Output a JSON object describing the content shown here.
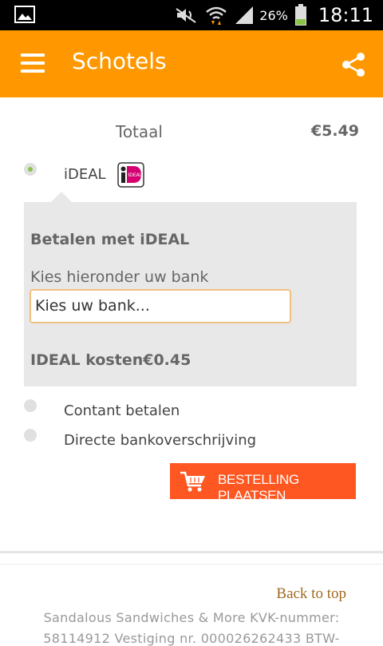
{
  "status_bar": {
    "battery_percent": "26%",
    "time": "18:11",
    "icons": [
      "gallery-icon",
      "mute-icon",
      "wifi-icon",
      "signal-icon",
      "battery-icon"
    ]
  },
  "app_bar": {
    "title": "Schotels",
    "menu_icon": "menu-icon",
    "share_icon": "share-icon",
    "color": "#FF9800"
  },
  "order": {
    "total_label": "Totaal",
    "total_value": "€5.49"
  },
  "payment_options": [
    {
      "label": "iDEAL",
      "selected": true
    },
    {
      "label": "Contant betalen",
      "selected": false
    },
    {
      "label": "Directe bankoverschrijving",
      "selected": false
    }
  ],
  "ideal_panel": {
    "title": "Betalen met iDEAL",
    "bank_prompt": "Kies hieronder uw bank",
    "bank_select_value": "Kies uw bank...",
    "costs_label": "IDEAL kosten€0.45"
  },
  "place_order_button": {
    "label": "BESTELLING PLAATSEN",
    "color": "#FF5722"
  },
  "footer": {
    "back_to_top": "Back to top",
    "line1": "Sandalous Sandwiches & More KVK-nummer:",
    "line2": "58114912 Vestiging nr. 000026262433 BTW-"
  }
}
